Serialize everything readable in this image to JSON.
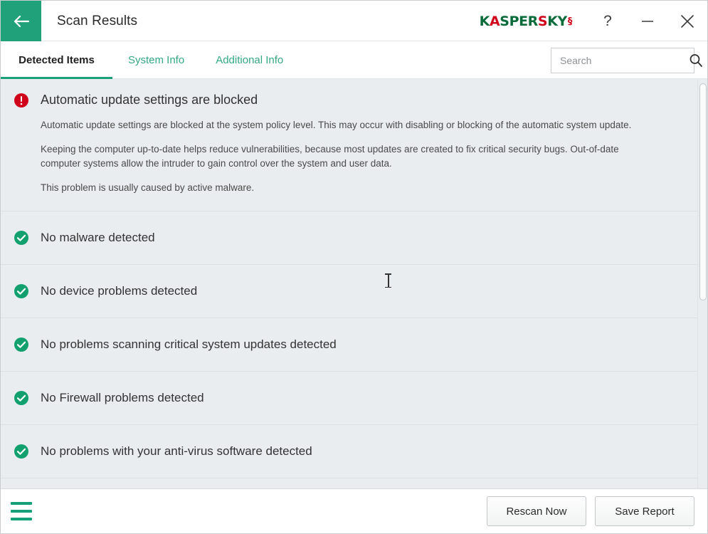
{
  "titlebar": {
    "back_icon": "arrow-left-icon",
    "title": "Scan Results",
    "brand_prefix": "K",
    "brand_a": "A",
    "brand_mid": "SPER",
    "brand_s": "S",
    "brand_suffix": "KY",
    "brand_mark": "§",
    "help_label": "?",
    "minimize_icon": "minimize-icon",
    "close_icon": "close-icon"
  },
  "tabs": [
    {
      "label": "Detected Items",
      "active": true
    },
    {
      "label": "System Info",
      "active": false
    },
    {
      "label": "Additional Info",
      "active": false
    }
  ],
  "search": {
    "placeholder": "Search",
    "value": "",
    "icon": "search-icon"
  },
  "results": [
    {
      "status": "alert",
      "title": "Automatic update settings are blocked",
      "paragraphs": [
        "Automatic update settings are blocked at the system policy level. This may occur with disabling or blocking of the automatic system update.",
        "Keeping the computer up-to-date helps reduce vulnerabilities, because most updates are created to fix critical security bugs. Out-of-date computer systems allow the intruder to gain control over the system and user data.",
        "This problem is usually caused by active malware."
      ]
    },
    {
      "status": "ok",
      "title": "No malware detected",
      "paragraphs": []
    },
    {
      "status": "ok",
      "title": "No device problems detected",
      "paragraphs": []
    },
    {
      "status": "ok",
      "title": "No problems scanning critical system updates detected",
      "paragraphs": []
    },
    {
      "status": "ok",
      "title": "No Firewall problems detected",
      "paragraphs": []
    },
    {
      "status": "ok",
      "title": "No problems with your anti-virus software detected",
      "paragraphs": []
    }
  ],
  "footer": {
    "menu_icon": "hamburger-menu-icon",
    "rescan_label": "Rescan Now",
    "save_label": "Save Report"
  },
  "colors": {
    "brand_green": "#21a179",
    "accent_green": "#1aa179",
    "link_green": "#35a883",
    "alert_red": "#d0021b",
    "ok_green": "#13a06f",
    "row_bg": "#e9edef"
  }
}
